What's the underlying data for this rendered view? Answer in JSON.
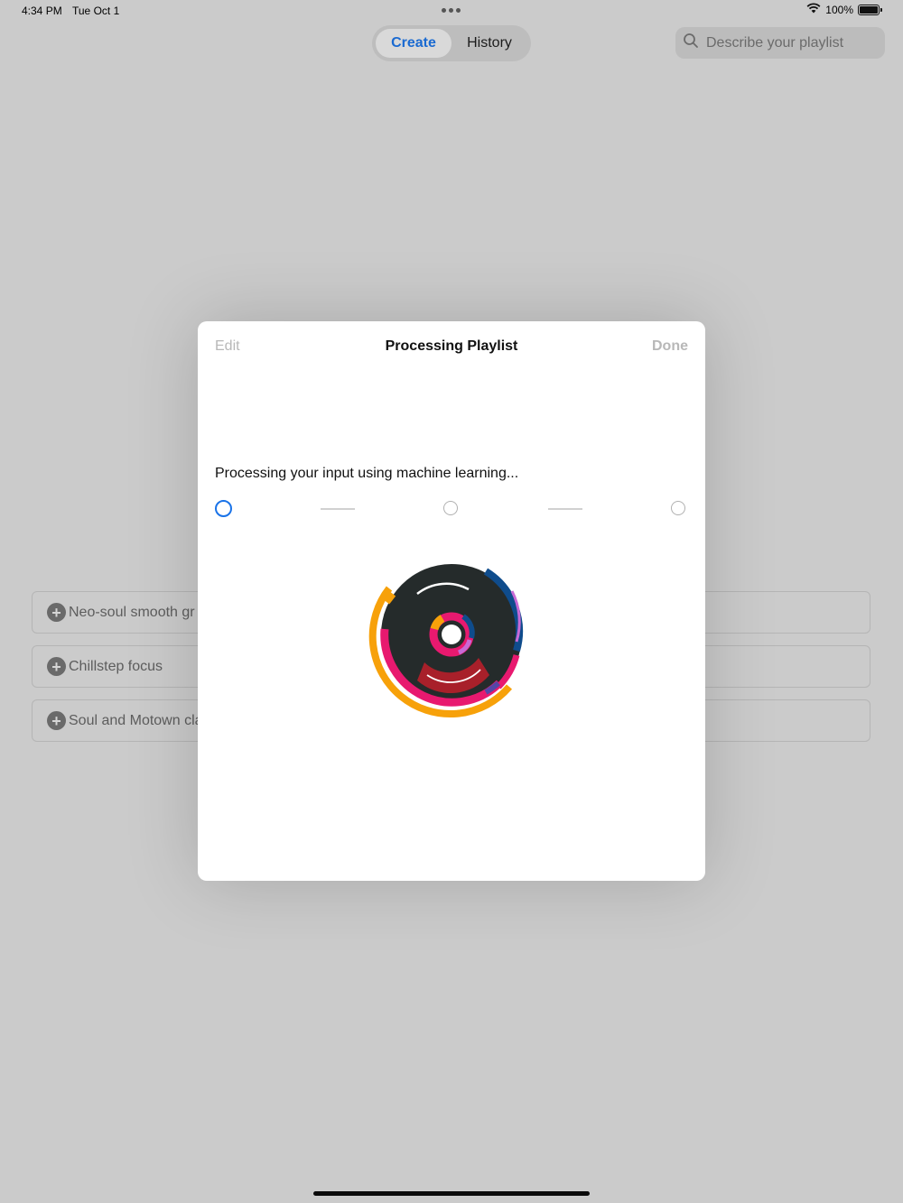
{
  "status_bar": {
    "time": "4:34 PM",
    "date": "Tue Oct 1",
    "battery": "100%"
  },
  "nav": {
    "tabs": [
      {
        "label": "Create",
        "active": true
      },
      {
        "label": "History",
        "active": false
      }
    ]
  },
  "search": {
    "placeholder": "Describe your playlist"
  },
  "background_list": [
    {
      "label": "Neo-soul smooth gr"
    },
    {
      "label": "Chillstep focus"
    },
    {
      "label": "Soul and Motown cla"
    }
  ],
  "modal": {
    "edit_label": "Edit",
    "title": "Processing Playlist",
    "done_label": "Done",
    "message": "Processing your input using machine learning...",
    "current_step": 1,
    "total_steps": 3
  },
  "colors": {
    "accent": "#1a73e8",
    "disc_dark": "#252b2b",
    "orange": "#f7a10a",
    "magenta": "#e8196f",
    "crimson": "#a8202a",
    "navy": "#0f4c8c",
    "violet": "#c86ad6"
  },
  "icons": {
    "search": "magnifier-icon",
    "wifi": "wifi-icon",
    "battery": "battery-icon",
    "add": "plus-circle-icon"
  }
}
